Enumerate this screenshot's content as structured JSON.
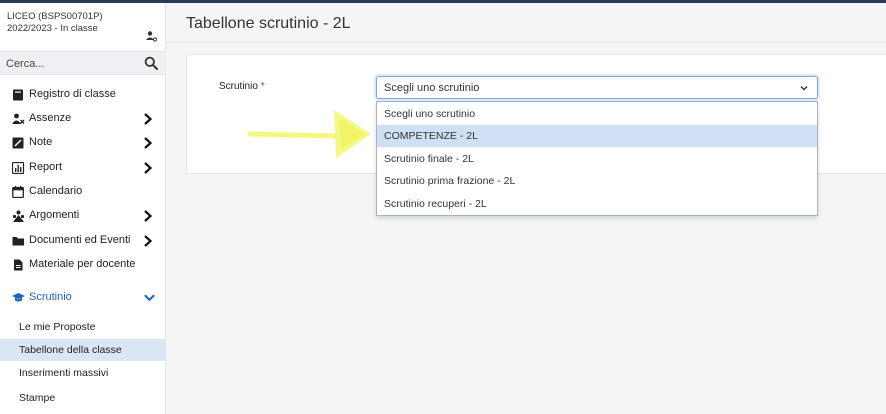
{
  "sidebar": {
    "school": "LICEO (BSPS00701P)",
    "year": "2022/2023 - In classe",
    "search_placeholder": "Cerca...",
    "items": [
      {
        "label": "Registro di classe"
      },
      {
        "label": "Assenze"
      },
      {
        "label": "Note"
      },
      {
        "label": "Report"
      },
      {
        "label": "Calendario"
      },
      {
        "label": "Argomenti"
      },
      {
        "label": "Documenti ed Eventi"
      },
      {
        "label": "Materiale per docente"
      },
      {
        "label": "Scrutinio"
      }
    ],
    "sub_items": [
      {
        "label": "Le mie Proposte"
      },
      {
        "label": "Tabellone della classe"
      },
      {
        "label": "Inserimenti massivi"
      },
      {
        "label": "Stampe"
      }
    ]
  },
  "main": {
    "title": "Tabellone scrutinio - 2L",
    "field_label": "Scrutinio",
    "required_mark": "*",
    "select_value": "Scegli uno scrutinio",
    "options": [
      "Scegli uno scrutinio",
      "COMPETENZE - 2L",
      "Scrutinio finale - 2L",
      "Scrutinio prima frazione - 2L",
      "Scrutinio recuperi - 2L"
    ],
    "highlighted_option": "COMPETENZE - 2L"
  },
  "colors": {
    "accent": "#1b63b8",
    "selected_bg": "#dbe6f4",
    "annotation": "#f3f56a"
  },
  "icons": {
    "year": "user-swap-icon",
    "search": "search-icon",
    "registro": "book-icon",
    "assenze": "user-x-icon",
    "note": "note-icon",
    "report": "chart-icon",
    "calendario": "calendar-icon",
    "argomenti": "users-icon",
    "documenti": "folder-icon",
    "materiale": "file-icon",
    "scrutinio": "graduation-cap-icon"
  }
}
